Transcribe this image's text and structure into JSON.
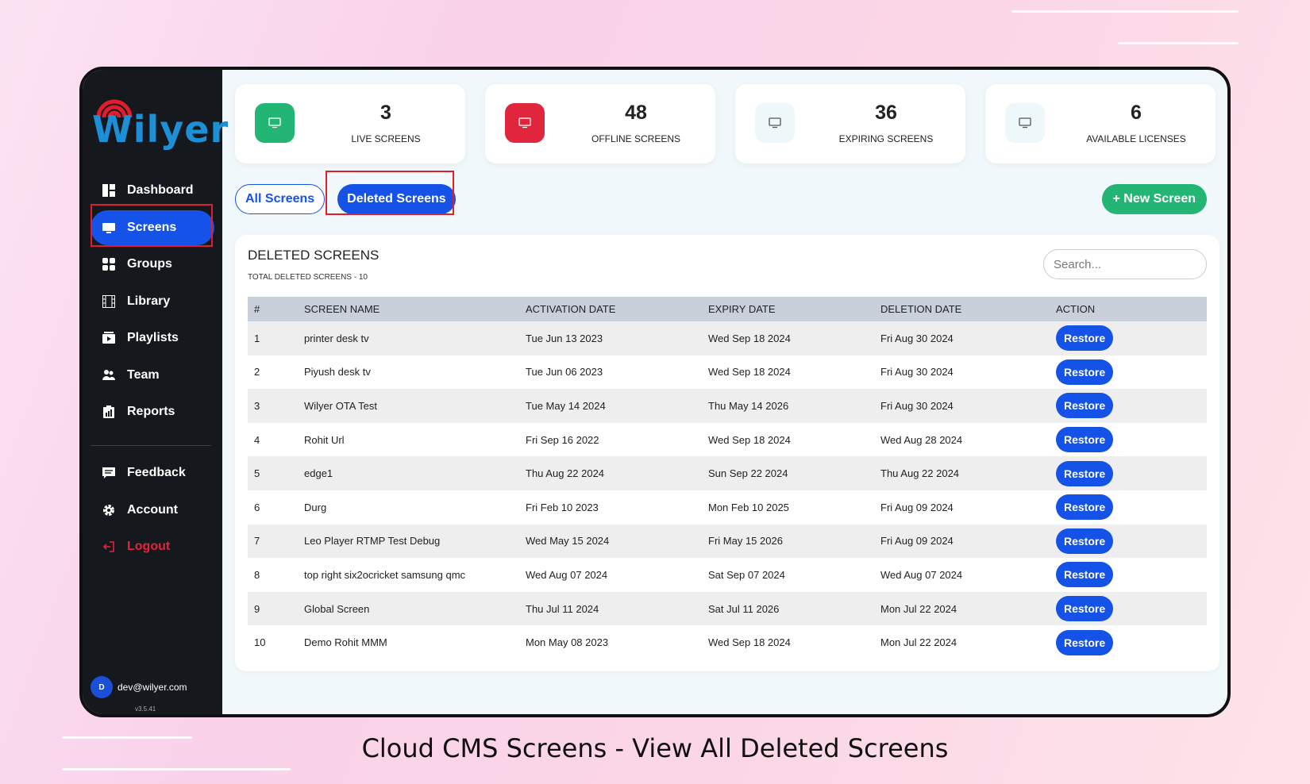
{
  "brand": {
    "name": "Wilyer",
    "accent": "#1552e8"
  },
  "sidebar": {
    "items": [
      {
        "label": "Dashboard",
        "icon": "dashboard-icon"
      },
      {
        "label": "Screens",
        "icon": "monitor-icon",
        "active": true
      },
      {
        "label": "Groups",
        "icon": "grid-icon"
      },
      {
        "label": "Library",
        "icon": "film-icon"
      },
      {
        "label": "Playlists",
        "icon": "playlist-icon"
      },
      {
        "label": "Team",
        "icon": "users-icon"
      },
      {
        "label": "Reports",
        "icon": "clipboard-icon"
      }
    ],
    "bottom_items": [
      {
        "label": "Feedback",
        "icon": "chat-icon"
      },
      {
        "label": "Account",
        "icon": "gear-icon"
      },
      {
        "label": "Logout",
        "icon": "logout-icon"
      }
    ],
    "user": {
      "initial": "D",
      "email": "dev@wilyer.com",
      "version": "v3.5.41"
    }
  },
  "stats": [
    {
      "value": "3",
      "label": "LIVE SCREENS",
      "color": "#22b573"
    },
    {
      "value": "48",
      "label": "OFFLINE SCREENS",
      "color": "#e0263c"
    },
    {
      "value": "36",
      "label": "EXPIRING SCREENS",
      "color": "#eef8fb"
    },
    {
      "value": "6",
      "label": "AVAILABLE LICENSES",
      "color": "#eef8fb"
    }
  ],
  "tabs": {
    "all": "All Screens",
    "deleted": "Deleted Screens"
  },
  "new_screen": "+ New Screen",
  "panel": {
    "title": "DELETED SCREENS",
    "subtitle": "TOTAL DELETED SCREENS - 10",
    "search_placeholder": "Search...",
    "columns": [
      "#",
      "SCREEN NAME",
      "ACTIVATION DATE",
      "EXPIRY DATE",
      "DELETION DATE",
      "ACTION"
    ],
    "rows": [
      [
        "1",
        "printer desk tv",
        "Tue Jun 13 2023",
        "Wed Sep 18 2024",
        "Fri Aug 30 2024"
      ],
      [
        "2",
        "Piyush desk tv",
        "Tue Jun 06 2023",
        "Wed Sep 18 2024",
        "Fri Aug 30 2024"
      ],
      [
        "3",
        "Wilyer OTA Test",
        "Tue May 14 2024",
        "Thu May 14 2026",
        "Fri Aug 30 2024"
      ],
      [
        "4",
        "Rohit Url",
        "Fri Sep 16 2022",
        "Wed Sep 18 2024",
        "Wed Aug 28 2024"
      ],
      [
        "5",
        "edge1",
        "Thu Aug 22 2024",
        "Sun Sep 22 2024",
        "Thu Aug 22 2024"
      ],
      [
        "6",
        "Durg",
        "Fri Feb 10 2023",
        "Mon Feb 10 2025",
        "Fri Aug 09 2024"
      ],
      [
        "7",
        "Leo Player RTMP Test Debug",
        "Wed May 15 2024",
        "Fri May 15 2026",
        "Fri Aug 09 2024"
      ],
      [
        "8",
        "top right six2ocricket samsung qmc",
        "Wed Aug 07 2024",
        "Sat Sep 07 2024",
        "Wed Aug 07 2024"
      ],
      [
        "9",
        "Global Screen",
        "Thu Jul 11 2024",
        "Sat Jul 11 2026",
        "Mon Jul 22 2024"
      ],
      [
        "10",
        "Demo Rohit MMM",
        "Mon May 08 2023",
        "Wed Sep 18 2024",
        "Mon Jul 22 2024"
      ]
    ],
    "action_label": "Restore"
  },
  "caption": "Cloud CMS Screens - View All Deleted Screens"
}
